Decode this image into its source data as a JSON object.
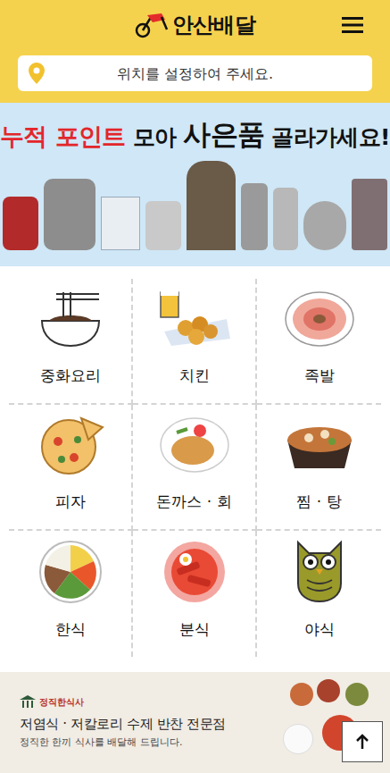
{
  "header": {
    "logo": "안산배달"
  },
  "location": {
    "placeholder": "위치를 설정하여 주세요."
  },
  "banner": {
    "title": [
      {
        "text": "누적 포인트",
        "kind": "highlight"
      },
      {
        "text": " 모아 ",
        "kind": "plain"
      },
      {
        "text": "사은품",
        "kind": "bold"
      },
      {
        "text": " 골라가세요!",
        "kind": "plain"
      }
    ]
  },
  "categories": [
    {
      "label": "중화요리"
    },
    {
      "label": "치킨"
    },
    {
      "label": "족발"
    },
    {
      "label": "피자"
    },
    {
      "label": "돈까스 · 회"
    },
    {
      "label": "찜 · 탕"
    },
    {
      "label": "한식"
    },
    {
      "label": "분식"
    },
    {
      "label": "야식"
    }
  ],
  "promo": {
    "brand": "정직한식사",
    "title": "저염식 · 저칼로리 수제 반찬 전문점",
    "subtitle": "정직한 한끼 식사를 배달해 드립니다."
  }
}
